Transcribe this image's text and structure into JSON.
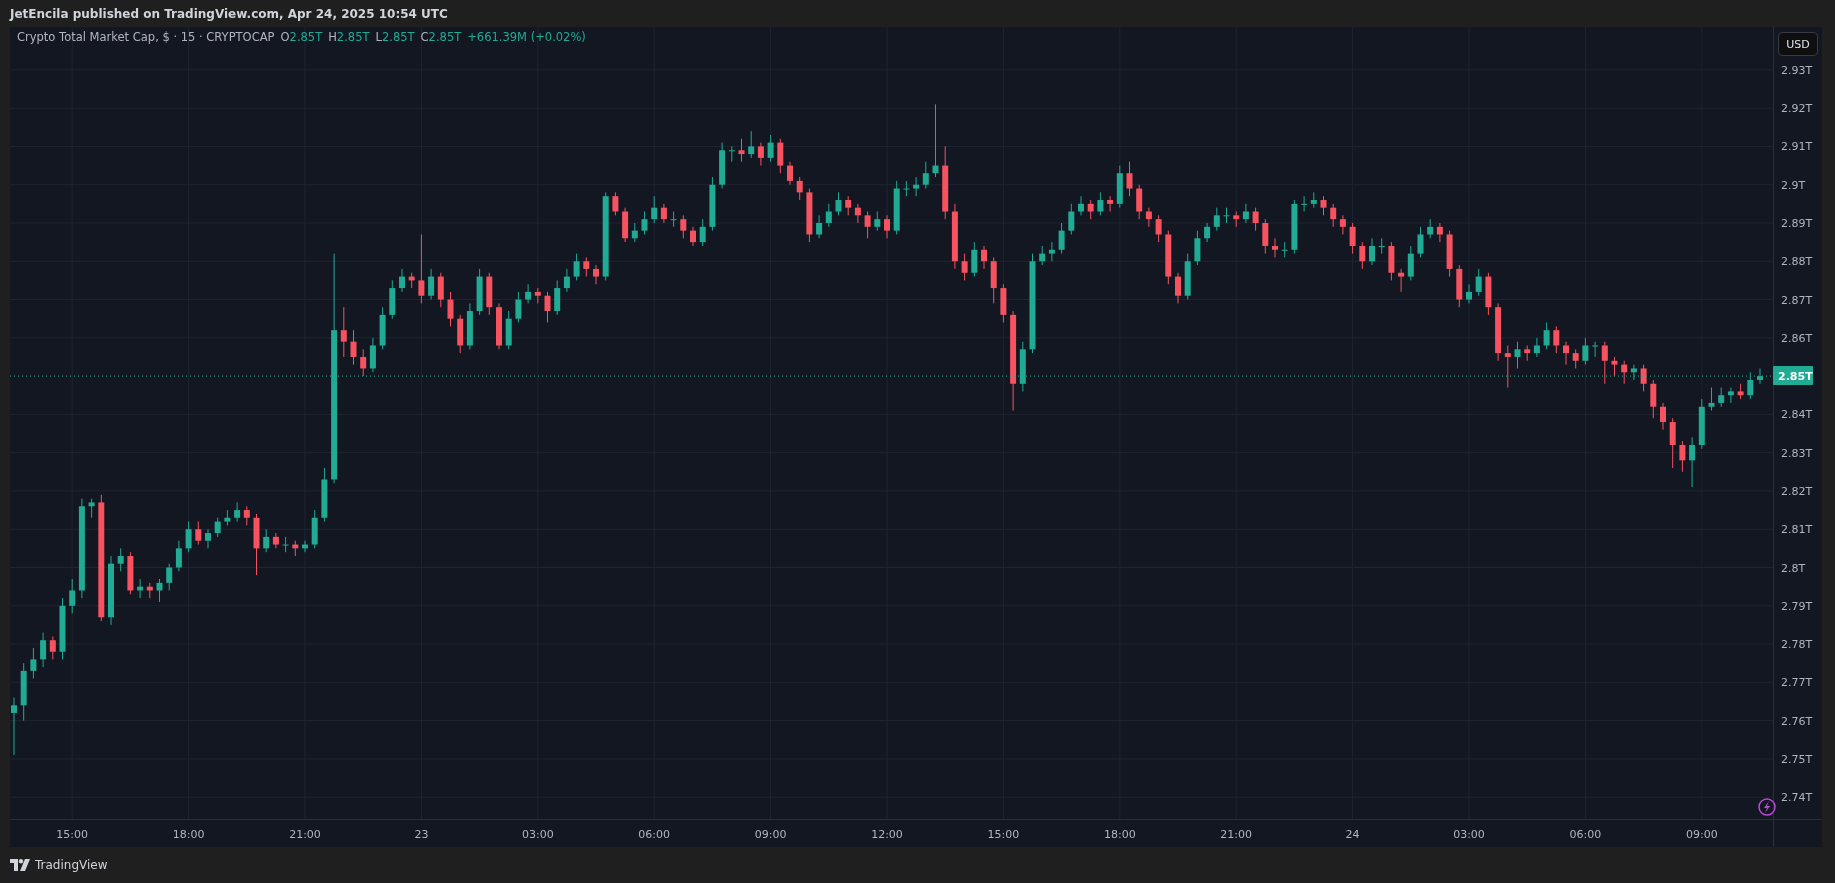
{
  "header": {
    "publisher": "JetEncila published on TradingView.com, Apr 24, 2025 10:54 UTC"
  },
  "legend": {
    "symbol": "Crypto Total Market Cap, $ · 15 · CRYPTOCAP",
    "values": [
      {
        "label": "O",
        "value": "2.85T"
      },
      {
        "label": "H",
        "value": "2.85T"
      },
      {
        "label": "L",
        "value": "2.85T"
      },
      {
        "label": "C",
        "value": "2.85T"
      }
    ],
    "change": "+661.39M (+0.02%)"
  },
  "price_axis": {
    "currency": "USD"
  },
  "chart_data": {
    "type": "candlestick",
    "categories": [
      null,
      null,
      null,
      null,
      null,
      null,
      "15:00",
      null,
      null,
      null,
      null,
      null,
      null,
      null,
      null,
      null,
      null,
      null,
      "18:00",
      null,
      null,
      null,
      null,
      null,
      null,
      null,
      null,
      null,
      null,
      null,
      "21:00",
      null,
      null,
      null,
      null,
      null,
      null,
      null,
      null,
      null,
      null,
      null,
      "23",
      null,
      null,
      null,
      null,
      null,
      null,
      null,
      null,
      null,
      null,
      null,
      "03:00",
      null,
      null,
      null,
      null,
      null,
      null,
      null,
      null,
      null,
      null,
      null,
      "06:00",
      null,
      null,
      null,
      null,
      null,
      null,
      null,
      null,
      null,
      null,
      null,
      "09:00",
      null,
      null,
      null,
      null,
      null,
      null,
      null,
      null,
      null,
      null,
      null,
      "12:00",
      null,
      null,
      null,
      null,
      null,
      null,
      null,
      null,
      null,
      null,
      null,
      "15:00",
      null,
      null,
      null,
      null,
      null,
      null,
      null,
      null,
      null,
      null,
      null,
      "18:00",
      null,
      null,
      null,
      null,
      null,
      null,
      null,
      null,
      null,
      null,
      null,
      "21:00",
      null,
      null,
      null,
      null,
      null,
      null,
      null,
      null,
      null,
      null,
      null,
      "24",
      null,
      null,
      null,
      null,
      null,
      null,
      null,
      null,
      null,
      null,
      null,
      "03:00",
      null,
      null,
      null,
      null,
      null,
      null,
      null,
      null,
      null,
      null,
      null,
      "06:00",
      null,
      null,
      null,
      null,
      null,
      null,
      null,
      null,
      null,
      null,
      null,
      "09:00",
      null,
      null,
      null,
      null,
      null,
      null
    ],
    "ylim": [
      2.7343,
      2.9412
    ],
    "grid": true,
    "ref_lines": [
      {
        "axis": "y",
        "value": 2.85,
        "label": "2.85T",
        "color": "#22ab94"
      }
    ],
    "ohlc": [
      [
        2.762,
        2.766,
        2.751,
        2.764
      ],
      [
        2.764,
        2.775,
        2.76,
        2.773
      ],
      [
        2.773,
        2.779,
        2.771,
        2.776
      ],
      [
        2.776,
        2.783,
        2.774,
        2.781
      ],
      [
        2.781,
        2.782,
        2.776,
        2.778
      ],
      [
        2.778,
        2.792,
        2.776,
        2.79
      ],
      [
        2.79,
        2.797,
        2.788,
        2.794
      ],
      [
        2.794,
        2.818,
        2.792,
        2.816
      ],
      [
        2.816,
        2.818,
        2.813,
        2.817
      ],
      [
        2.817,
        2.819,
        2.786,
        2.787
      ],
      [
        2.787,
        2.803,
        2.785,
        2.801
      ],
      [
        2.801,
        2.805,
        2.799,
        2.803
      ],
      [
        2.803,
        2.804,
        2.793,
        2.794
      ],
      [
        2.794,
        2.797,
        2.792,
        2.795
      ],
      [
        2.795,
        2.796,
        2.792,
        2.794
      ],
      [
        2.794,
        2.797,
        2.791,
        2.796
      ],
      [
        2.796,
        2.801,
        2.794,
        2.8
      ],
      [
        2.8,
        2.807,
        2.799,
        2.805
      ],
      [
        2.805,
        2.812,
        2.804,
        2.81
      ],
      [
        2.81,
        2.812,
        2.806,
        2.807
      ],
      [
        2.807,
        2.81,
        2.805,
        2.809
      ],
      [
        2.809,
        2.813,
        2.808,
        2.812
      ],
      [
        2.812,
        2.815,
        2.811,
        2.813
      ],
      [
        2.813,
        2.817,
        2.812,
        2.815
      ],
      [
        2.815,
        2.816,
        2.811,
        2.813
      ],
      [
        2.813,
        2.814,
        2.798,
        2.805
      ],
      [
        2.805,
        2.81,
        2.804,
        2.808
      ],
      [
        2.808,
        2.809,
        2.805,
        2.806
      ],
      [
        2.806,
        2.808,
        2.804,
        2.806
      ],
      [
        2.806,
        2.807,
        2.803,
        2.805
      ],
      [
        2.805,
        2.807,
        2.804,
        2.806
      ],
      [
        2.806,
        2.815,
        2.805,
        2.813
      ],
      [
        2.813,
        2.826,
        2.812,
        2.823
      ],
      [
        2.823,
        2.882,
        2.822,
        2.862
      ],
      [
        2.862,
        2.868,
        2.855,
        2.859
      ],
      [
        2.859,
        2.862,
        2.853,
        2.855
      ],
      [
        2.855,
        2.857,
        2.85,
        2.852
      ],
      [
        2.852,
        2.86,
        2.851,
        2.858
      ],
      [
        2.858,
        2.868,
        2.857,
        2.866
      ],
      [
        2.866,
        2.875,
        2.865,
        2.873
      ],
      [
        2.873,
        2.878,
        2.872,
        2.876
      ],
      [
        2.876,
        2.877,
        2.873,
        2.875
      ],
      [
        2.875,
        2.887,
        2.869,
        2.871
      ],
      [
        2.871,
        2.878,
        2.87,
        2.876
      ],
      [
        2.876,
        2.877,
        2.868,
        2.87
      ],
      [
        2.87,
        2.872,
        2.863,
        2.865
      ],
      [
        2.865,
        2.866,
        2.856,
        2.858
      ],
      [
        2.858,
        2.869,
        2.857,
        2.867
      ],
      [
        2.867,
        2.878,
        2.866,
        2.876
      ],
      [
        2.876,
        2.877,
        2.866,
        2.868
      ],
      [
        2.868,
        2.869,
        2.857,
        2.858
      ],
      [
        2.858,
        2.867,
        2.857,
        2.865
      ],
      [
        2.865,
        2.872,
        2.864,
        2.87
      ],
      [
        2.87,
        2.874,
        2.869,
        2.872
      ],
      [
        2.872,
        2.873,
        2.869,
        2.871
      ],
      [
        2.871,
        2.872,
        2.864,
        2.867
      ],
      [
        2.867,
        2.875,
        2.866,
        2.873
      ],
      [
        2.873,
        2.878,
        2.872,
        2.876
      ],
      [
        2.876,
        2.882,
        2.875,
        2.88
      ],
      [
        2.88,
        2.881,
        2.876,
        2.878
      ],
      [
        2.878,
        2.879,
        2.874,
        2.876
      ],
      [
        2.876,
        2.898,
        2.875,
        2.897
      ],
      [
        2.897,
        2.898,
        2.892,
        2.893
      ],
      [
        2.893,
        2.894,
        2.885,
        2.886
      ],
      [
        2.886,
        2.89,
        2.885,
        2.888
      ],
      [
        2.888,
        2.893,
        2.887,
        2.891
      ],
      [
        2.891,
        2.897,
        2.89,
        2.894
      ],
      [
        2.894,
        2.895,
        2.89,
        2.891
      ],
      [
        2.891,
        2.893,
        2.889,
        2.891
      ],
      [
        2.891,
        2.892,
        2.886,
        2.888
      ],
      [
        2.888,
        2.889,
        2.884,
        2.885
      ],
      [
        2.885,
        2.891,
        2.884,
        2.889
      ],
      [
        2.889,
        2.902,
        2.888,
        2.9
      ],
      [
        2.9,
        2.911,
        2.899,
        2.909
      ],
      [
        2.909,
        2.91,
        2.906,
        2.909
      ],
      [
        2.909,
        2.912,
        2.906,
        2.908
      ],
      [
        2.908,
        2.914,
        2.907,
        2.91
      ],
      [
        2.91,
        2.911,
        2.905,
        2.907
      ],
      [
        2.907,
        2.913,
        2.906,
        2.911
      ],
      [
        2.911,
        2.912,
        2.903,
        2.905
      ],
      [
        2.905,
        2.906,
        2.9,
        2.901
      ],
      [
        2.901,
        2.902,
        2.896,
        2.898
      ],
      [
        2.898,
        2.899,
        2.885,
        2.887
      ],
      [
        2.887,
        2.892,
        2.886,
        2.89
      ],
      [
        2.89,
        2.895,
        2.889,
        2.893
      ],
      [
        2.893,
        2.898,
        2.892,
        2.896
      ],
      [
        2.896,
        2.897,
        2.892,
        2.894
      ],
      [
        2.894,
        2.895,
        2.89,
        2.892
      ],
      [
        2.892,
        2.893,
        2.886,
        2.889
      ],
      [
        2.889,
        2.893,
        2.888,
        2.891
      ],
      [
        2.891,
        2.892,
        2.886,
        2.888
      ],
      [
        2.888,
        2.901,
        2.887,
        2.899
      ],
      [
        2.899,
        2.901,
        2.897,
        2.899
      ],
      [
        2.899,
        2.902,
        2.897,
        2.9
      ],
      [
        2.9,
        2.906,
        2.899,
        2.903
      ],
      [
        2.903,
        2.921,
        2.902,
        2.905
      ],
      [
        2.905,
        2.91,
        2.891,
        2.893
      ],
      [
        2.893,
        2.895,
        2.878,
        2.88
      ],
      [
        2.88,
        2.882,
        2.875,
        2.877
      ],
      [
        2.877,
        2.885,
        2.876,
        2.883
      ],
      [
        2.883,
        2.884,
        2.878,
        2.88
      ],
      [
        2.88,
        2.881,
        2.869,
        2.873
      ],
      [
        2.873,
        2.874,
        2.864,
        2.866
      ],
      [
        2.866,
        2.867,
        2.841,
        2.848
      ],
      [
        2.848,
        2.859,
        2.846,
        2.857
      ],
      [
        2.857,
        2.882,
        2.856,
        2.88
      ],
      [
        2.88,
        2.884,
        2.879,
        2.882
      ],
      [
        2.882,
        2.885,
        2.88,
        2.883
      ],
      [
        2.883,
        2.89,
        2.882,
        2.888
      ],
      [
        2.888,
        2.895,
        2.887,
        2.893
      ],
      [
        2.893,
        2.897,
        2.892,
        2.895
      ],
      [
        2.895,
        2.896,
        2.891,
        2.893
      ],
      [
        2.893,
        2.898,
        2.892,
        2.896
      ],
      [
        2.896,
        2.897,
        2.893,
        2.895
      ],
      [
        2.895,
        2.905,
        2.894,
        2.903
      ],
      [
        2.903,
        2.906,
        2.897,
        2.899
      ],
      [
        2.899,
        2.9,
        2.891,
        2.893
      ],
      [
        2.893,
        2.894,
        2.889,
        2.891
      ],
      [
        2.891,
        2.892,
        2.885,
        2.887
      ],
      [
        2.887,
        2.888,
        2.874,
        2.876
      ],
      [
        2.876,
        2.877,
        2.869,
        2.871
      ],
      [
        2.871,
        2.882,
        2.87,
        2.88
      ],
      [
        2.88,
        2.888,
        2.879,
        2.886
      ],
      [
        2.886,
        2.89,
        2.885,
        2.889
      ],
      [
        2.889,
        2.894,
        2.888,
        2.892
      ],
      [
        2.892,
        2.894,
        2.89,
        2.892
      ],
      [
        2.892,
        2.893,
        2.889,
        2.891
      ],
      [
        2.891,
        2.895,
        2.89,
        2.893
      ],
      [
        2.893,
        2.894,
        2.888,
        2.89
      ],
      [
        2.89,
        2.891,
        2.882,
        2.884
      ],
      [
        2.884,
        2.886,
        2.881,
        2.883
      ],
      [
        2.883,
        2.885,
        2.881,
        2.883
      ],
      [
        2.883,
        2.896,
        2.882,
        2.895
      ],
      [
        2.895,
        2.897,
        2.893,
        2.895
      ],
      [
        2.895,
        2.898,
        2.894,
        2.896
      ],
      [
        2.896,
        2.897,
        2.892,
        2.894
      ],
      [
        2.894,
        2.895,
        2.889,
        2.891
      ],
      [
        2.891,
        2.892,
        2.887,
        2.889
      ],
      [
        2.889,
        2.89,
        2.882,
        2.884
      ],
      [
        2.884,
        2.885,
        2.878,
        2.88
      ],
      [
        2.88,
        2.886,
        2.879,
        2.884
      ],
      [
        2.884,
        2.886,
        2.882,
        2.884
      ],
      [
        2.884,
        2.885,
        2.875,
        2.877
      ],
      [
        2.877,
        2.878,
        2.872,
        2.876
      ],
      [
        2.876,
        2.884,
        2.875,
        2.882
      ],
      [
        2.882,
        2.889,
        2.881,
        2.887
      ],
      [
        2.887,
        2.891,
        2.886,
        2.889
      ],
      [
        2.889,
        2.89,
        2.885,
        2.887
      ],
      [
        2.887,
        2.888,
        2.876,
        2.878
      ],
      [
        2.878,
        2.879,
        2.868,
        2.87
      ],
      [
        2.87,
        2.874,
        2.869,
        2.872
      ],
      [
        2.872,
        2.878,
        2.871,
        2.876
      ],
      [
        2.876,
        2.877,
        2.866,
        2.868
      ],
      [
        2.868,
        2.869,
        2.854,
        2.856
      ],
      [
        2.856,
        2.858,
        2.847,
        2.855
      ],
      [
        2.855,
        2.859,
        2.852,
        2.857
      ],
      [
        2.857,
        2.858,
        2.854,
        2.856
      ],
      [
        2.856,
        2.86,
        2.855,
        2.858
      ],
      [
        2.858,
        2.864,
        2.857,
        2.862
      ],
      [
        2.862,
        2.863,
        2.856,
        2.858
      ],
      [
        2.858,
        2.859,
        2.853,
        2.856
      ],
      [
        2.856,
        2.857,
        2.852,
        2.854
      ],
      [
        2.854,
        2.86,
        2.853,
        2.858
      ],
      [
        2.858,
        2.859,
        2.855,
        2.858
      ],
      [
        2.858,
        2.859,
        2.848,
        2.854
      ],
      [
        2.854,
        2.855,
        2.85,
        2.853
      ],
      [
        2.853,
        2.854,
        2.848,
        2.851
      ],
      [
        2.851,
        2.853,
        2.849,
        2.852
      ],
      [
        2.852,
        2.853,
        2.846,
        2.848
      ],
      [
        2.848,
        2.849,
        2.839,
        2.842
      ],
      [
        2.842,
        2.843,
        2.836,
        2.838
      ],
      [
        2.838,
        2.839,
        2.826,
        2.832
      ],
      [
        2.832,
        2.833,
        2.825,
        2.828
      ],
      [
        2.828,
        2.834,
        2.821,
        2.832
      ],
      [
        2.832,
        2.844,
        2.831,
        2.842
      ],
      [
        2.842,
        2.847,
        2.841,
        2.843
      ],
      [
        2.843,
        2.847,
        2.842,
        2.845
      ],
      [
        2.845,
        2.847,
        2.843,
        2.846
      ],
      [
        2.846,
        2.848,
        2.844,
        2.845
      ],
      [
        2.845,
        2.851,
        2.844,
        2.849
      ],
      [
        2.849,
        2.852,
        2.848,
        2.85
      ]
    ],
    "yticks": [
      {
        "value": 2.93,
        "label": "2.93T"
      },
      {
        "value": 2.92,
        "label": "2.92T"
      },
      {
        "value": 2.91,
        "label": "2.91T"
      },
      {
        "value": 2.9,
        "label": "2.9T"
      },
      {
        "value": 2.89,
        "label": "2.89T"
      },
      {
        "value": 2.88,
        "label": "2.88T"
      },
      {
        "value": 2.87,
        "label": "2.87T"
      },
      {
        "value": 2.86,
        "label": "2.86T"
      },
      {
        "value": 2.84,
        "label": "2.84T"
      },
      {
        "value": 2.83,
        "label": "2.83T"
      },
      {
        "value": 2.82,
        "label": "2.82T"
      },
      {
        "value": 2.81,
        "label": "2.81T"
      },
      {
        "value": 2.8,
        "label": "2.8T"
      },
      {
        "value": 2.79,
        "label": "2.79T"
      },
      {
        "value": 2.78,
        "label": "2.78T"
      },
      {
        "value": 2.77,
        "label": "2.77T"
      },
      {
        "value": 2.76,
        "label": "2.76T"
      },
      {
        "value": 2.75,
        "label": "2.75T"
      },
      {
        "value": 2.74,
        "label": "2.74T"
      }
    ]
  },
  "footer": {
    "brand": "TradingView"
  }
}
